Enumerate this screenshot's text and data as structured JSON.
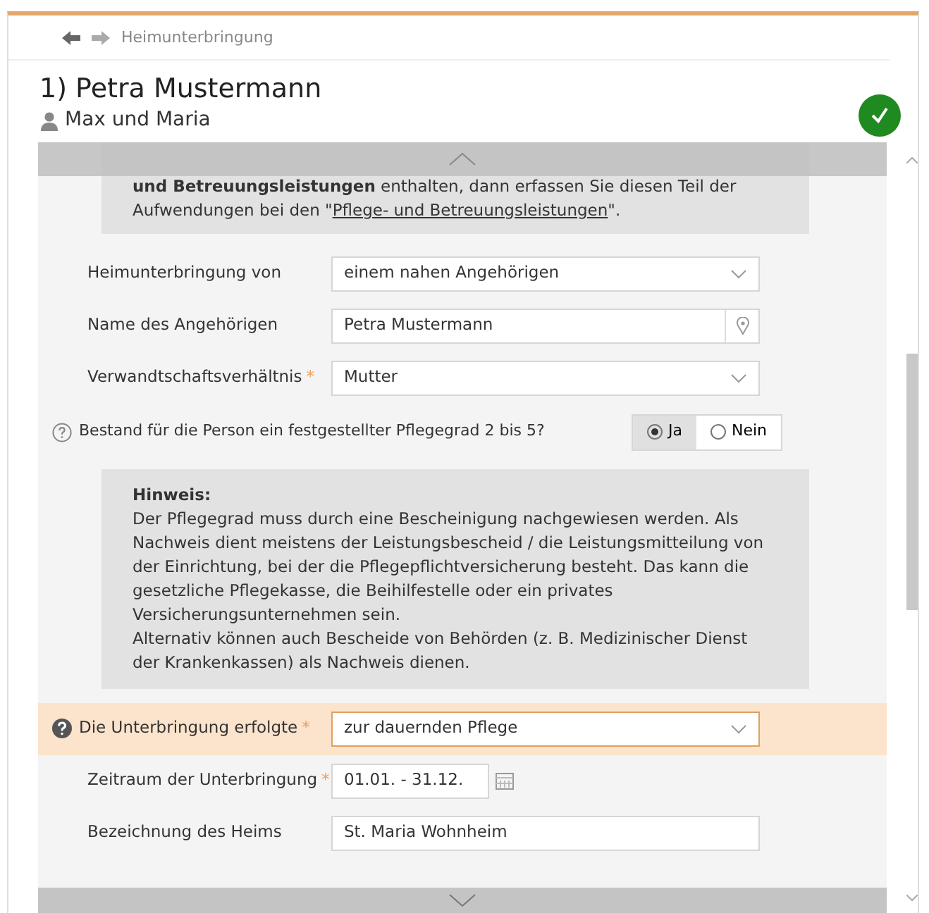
{
  "breadcrumb": {
    "title": "Heimunterbringung"
  },
  "header": {
    "title": "1) Petra Mustermann",
    "subtitle": "Max und Maria",
    "complete": true
  },
  "top_hint": {
    "text_before": "**und Betreuungsleistungen** enthalten, dann erfassen Sie diesen Teil der Aufwendungen bei den \"",
    "link": "Pflege- und Betreuungsleistungen",
    "text_after": "\"."
  },
  "fields_a": [
    {
      "kind": "select",
      "label": "Heimunterbringung von",
      "value": "einem nahen Angehörigen"
    },
    {
      "kind": "text",
      "label": "Name des Angehörigen",
      "value": "Petra Mustermann"
    },
    {
      "kind": "select",
      "label": "Verwandtschaftsverhältnis",
      "required_mark": "*",
      "value": "Mutter"
    }
  ],
  "question": {
    "label": "Bestand für die Person ein festgestellter Pflegegrad 2 bis 5?",
    "options": [
      {
        "label": "Ja",
        "selected": true
      },
      {
        "label": "Nein",
        "selected": false
      }
    ]
  },
  "hint": {
    "title": "Hinweis:",
    "paragraphs": [
      "Der Pflegegrad muss durch eine Bescheinigung nachgewiesen werden. Als Nachweis dient meistens der Leistungsbescheid / die Leistungsmitteilung von der Einrichtung, bei der die Pflegepflichtversicherung besteht. Das kann die gesetzliche Pflegekasse, die Beihilfestelle oder ein privates Versicherungsunternehmen sein.",
      "Alternativ können auch Bescheide von Behörden (z. B. Medizinischer Dienst der Krankenkassen) als Nachweis dienen."
    ]
  },
  "fields_b": [
    {
      "kind": "select",
      "label": "Die Unterbringung erfolgte",
      "required_mark": "*",
      "value": "zur dauernden Pflege",
      "highlighted": true
    },
    {
      "kind": "date",
      "label": "Zeitraum der Unterbringung",
      "required_mark": "*",
      "value": "01.01. - 31.12.",
      "highlighted": false
    },
    {
      "kind": "text",
      "label": "Bezeichnung des Heims",
      "value": "St. Maria Wohnheim",
      "highlighted": false
    }
  ]
}
